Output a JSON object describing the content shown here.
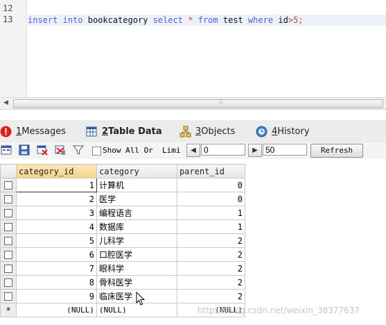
{
  "editor": {
    "line_numbers": [
      "12",
      "13"
    ],
    "code": {
      "insert": "insert",
      "into": "into",
      "table": "bookcategory",
      "select": "select",
      "star": "*",
      "from": "from",
      "source": "test",
      "where": "where",
      "column": "id",
      "op": ">",
      "value": "5",
      "end": ";"
    }
  },
  "scrollbar": {
    "grip": "⦙⦙⦙"
  },
  "tabs": [
    {
      "key": "1",
      "label": " Messages",
      "icon": "error-icon"
    },
    {
      "key": "2",
      "label": " Table Data",
      "icon": "table-icon",
      "active": true
    },
    {
      "key": "3",
      "label": " Objects",
      "icon": "objects-icon"
    },
    {
      "key": "4",
      "label": " History",
      "icon": "history-icon"
    }
  ],
  "toolbar": {
    "show_all_label": "Show All Or",
    "limit_label": "Limi",
    "offset_value": "0",
    "limit_value": "50",
    "refresh_label": "Refresh"
  },
  "grid": {
    "columns": [
      "category_id",
      "category",
      "parent_id"
    ],
    "rows": [
      {
        "category_id": "1",
        "category": "计算机",
        "parent_id": "0"
      },
      {
        "category_id": "2",
        "category": "医学",
        "parent_id": "0"
      },
      {
        "category_id": "3",
        "category": "编程语言",
        "parent_id": "1"
      },
      {
        "category_id": "4",
        "category": "数据库",
        "parent_id": "1"
      },
      {
        "category_id": "5",
        "category": "儿科学",
        "parent_id": "2"
      },
      {
        "category_id": "6",
        "category": "口腔医学",
        "parent_id": "2"
      },
      {
        "category_id": "7",
        "category": "眼科学",
        "parent_id": "2"
      },
      {
        "category_id": "8",
        "category": "骨科医学",
        "parent_id": "2"
      },
      {
        "category_id": "9",
        "category": "临床医学",
        "parent_id": "2"
      }
    ],
    "new_row_marker": "*",
    "null_text": "(NULL)"
  },
  "watermark": "https://blog.csdn.net/weixin_38377637",
  "colors": {
    "keyword": "#5b5bd4",
    "number": "#c04040",
    "header_selected": "#f2d48c"
  }
}
